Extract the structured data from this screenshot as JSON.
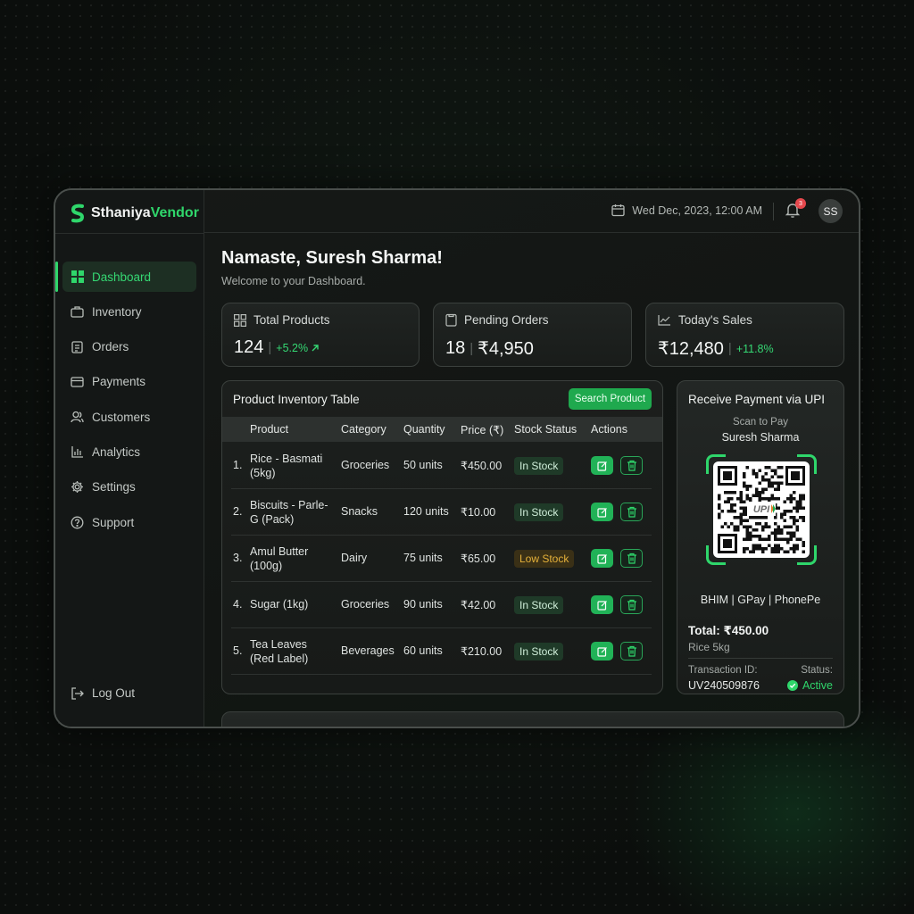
{
  "brand": {
    "name_part1": "Sthaniya",
    "name_part2": "Vendor"
  },
  "header": {
    "datetime": "Wed Dec, 2023, 12:00 AM",
    "notification_count": "3",
    "avatar_initials": "SS"
  },
  "sidebar": {
    "items": [
      {
        "label": "Dashboard",
        "icon": "grid-icon",
        "active": true
      },
      {
        "label": "Inventory",
        "icon": "briefcase-icon"
      },
      {
        "label": "Orders",
        "icon": "clipboard-icon"
      },
      {
        "label": "Payments",
        "icon": "credit-card-icon"
      },
      {
        "label": "Customers",
        "icon": "users-icon"
      },
      {
        "label": "Analytics",
        "icon": "bar-chart-icon"
      },
      {
        "label": "Settings",
        "icon": "gear-icon"
      },
      {
        "label": "Support",
        "icon": "help-icon"
      }
    ],
    "logout_label": "Log Out"
  },
  "main": {
    "greeting": "Namaste, Suresh Sharma!",
    "subtitle": "Welcome to your Dashboard."
  },
  "stats": [
    {
      "title": "Total Products",
      "value": "124",
      "delta": "+5.2%"
    },
    {
      "title": "Pending Orders",
      "value": "18",
      "extra": "₹4,950"
    },
    {
      "title": "Today's Sales",
      "value": "₹12,480",
      "delta": "+11.8%"
    }
  ],
  "inventory": {
    "title": "Product Inventory Table",
    "search_label": "Search Product",
    "columns": [
      "Product",
      "Category",
      "Quantity",
      "Price (₹)",
      "Stock Status",
      "Actions"
    ],
    "rows": [
      {
        "num": "1.",
        "product_l1": "Rice - Basmati",
        "product_l2": "(5kg)",
        "category": "Groceries",
        "quantity": "50 units",
        "price": "₹450.00",
        "status": "In Stock"
      },
      {
        "num": "2.",
        "product_l1": "Biscuits - Parle-",
        "product_l2": "G (Pack)",
        "category": "Snacks",
        "quantity": "120 units",
        "price": "₹10.00",
        "status": "In Stock"
      },
      {
        "num": "3.",
        "product_l1": "Amul Butter",
        "product_l2": "(100g)",
        "category": "Dairy",
        "quantity": "75 units",
        "price": "₹65.00",
        "status": "Low Stock"
      },
      {
        "num": "4.",
        "product_l1": "Sugar (1kg)",
        "product_l2": "",
        "category": "Groceries",
        "quantity": "90 units",
        "price": "₹42.00",
        "status": "In Stock"
      },
      {
        "num": "5.",
        "product_l1": "Tea Leaves",
        "product_l2": "(Red Label)",
        "category": "Beverages",
        "quantity": "60 units",
        "price": "₹210.00",
        "status": "In Stock"
      }
    ]
  },
  "upi": {
    "title": "Receive Payment via UPI",
    "scan_label": "Scan to Pay",
    "payee": "Suresh Sharma",
    "qr_logo": "UPI",
    "apps": "BHIM | GPay | PhonePe",
    "total": "Total: ₹450.00",
    "item": "Rice 5kg",
    "txn_label": "Transaction ID:",
    "txn_id": "UV240509876",
    "status_label": "Status:",
    "status_value": "Active"
  },
  "colors": {
    "accent": "#2fd66b",
    "low_stock": "#e5b13a",
    "background": "#0c0f0d"
  }
}
